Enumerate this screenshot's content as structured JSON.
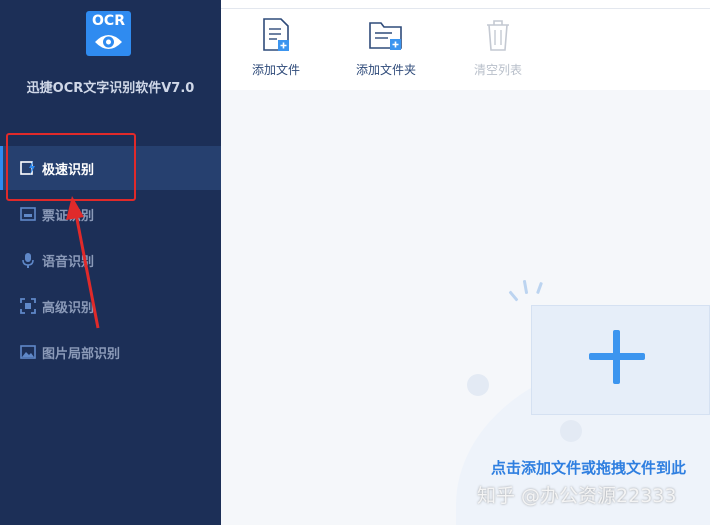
{
  "app": {
    "logo_text": "OCR",
    "title": "迅捷OCR文字识别软件V7.0"
  },
  "sidebar": {
    "items": [
      {
        "label": "极速识别",
        "icon": "quick-recognize-icon",
        "active": true
      },
      {
        "label": "票证识别",
        "icon": "ticket-icon",
        "active": false
      },
      {
        "label": "语音识别",
        "icon": "microphone-icon",
        "active": false
      },
      {
        "label": "高级识别",
        "icon": "scan-frame-icon",
        "active": false
      },
      {
        "label": "图片局部识别",
        "icon": "image-icon",
        "active": false
      }
    ]
  },
  "toolbar": {
    "add_file": "添加文件",
    "add_folder": "添加文件夹",
    "clear_list": "清空列表"
  },
  "main": {
    "drop_hint": "点击添加文件或拖拽文件到此"
  },
  "watermark": "知乎 @办公资源22333",
  "colors": {
    "sidebar_bg": "#1c2f57",
    "accent": "#2f8bf0",
    "annotation_red": "#e02a2a"
  }
}
